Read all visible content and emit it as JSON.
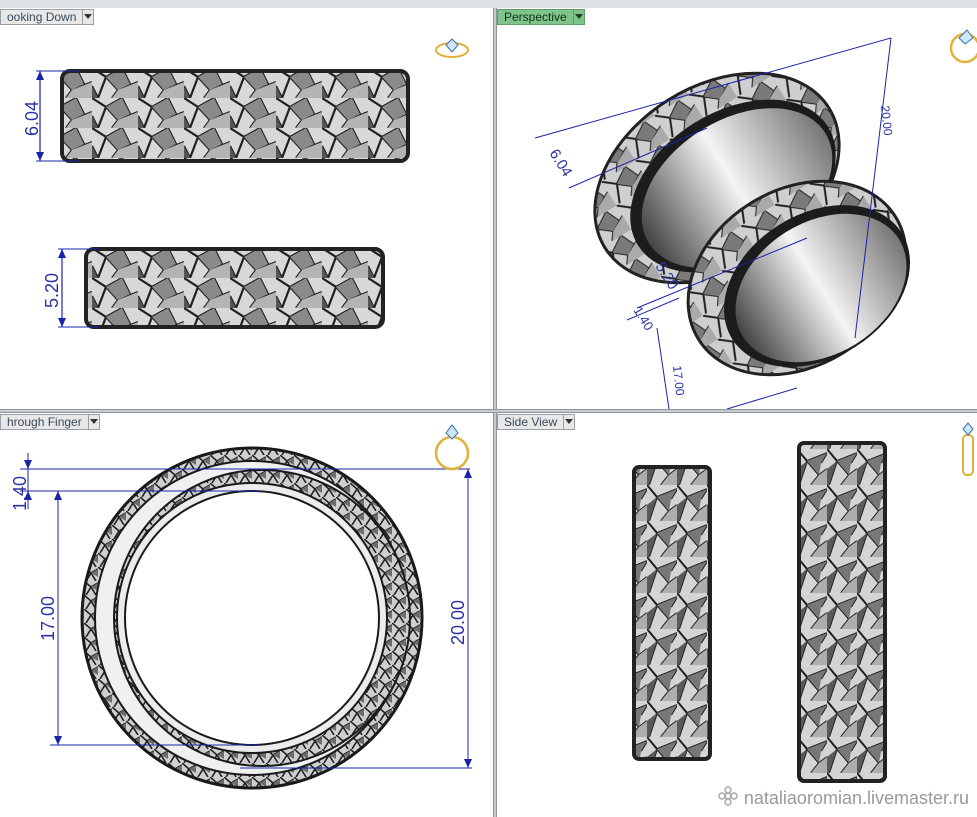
{
  "viewports": {
    "top_left": {
      "label": "ooking Down"
    },
    "top_right": {
      "label": "Perspective"
    },
    "bottom_left": {
      "label": "hrough Finger"
    },
    "bottom_right": {
      "label": "Side View"
    }
  },
  "dimensions": {
    "looking_down": {
      "upper_ring_width": "6.04",
      "lower_ring_width": "5.20"
    },
    "perspective": {
      "ring_a_width": "6.04",
      "diameter": "20.00",
      "ring_b_width": "5.20",
      "thickness": "1.40",
      "inner_diameter": "17.00"
    },
    "through_finger": {
      "thickness": "1.40",
      "inner_diameter": "17.00",
      "outer_diameter": "20.00"
    }
  },
  "watermark": {
    "text": "nataliaoromian.livemaster.ru"
  },
  "colors": {
    "dimension": "#1a24a8",
    "active_view": "#7fc48a",
    "ring_dark": "#2b2b2b",
    "ring_light": "#f2f2f2"
  }
}
